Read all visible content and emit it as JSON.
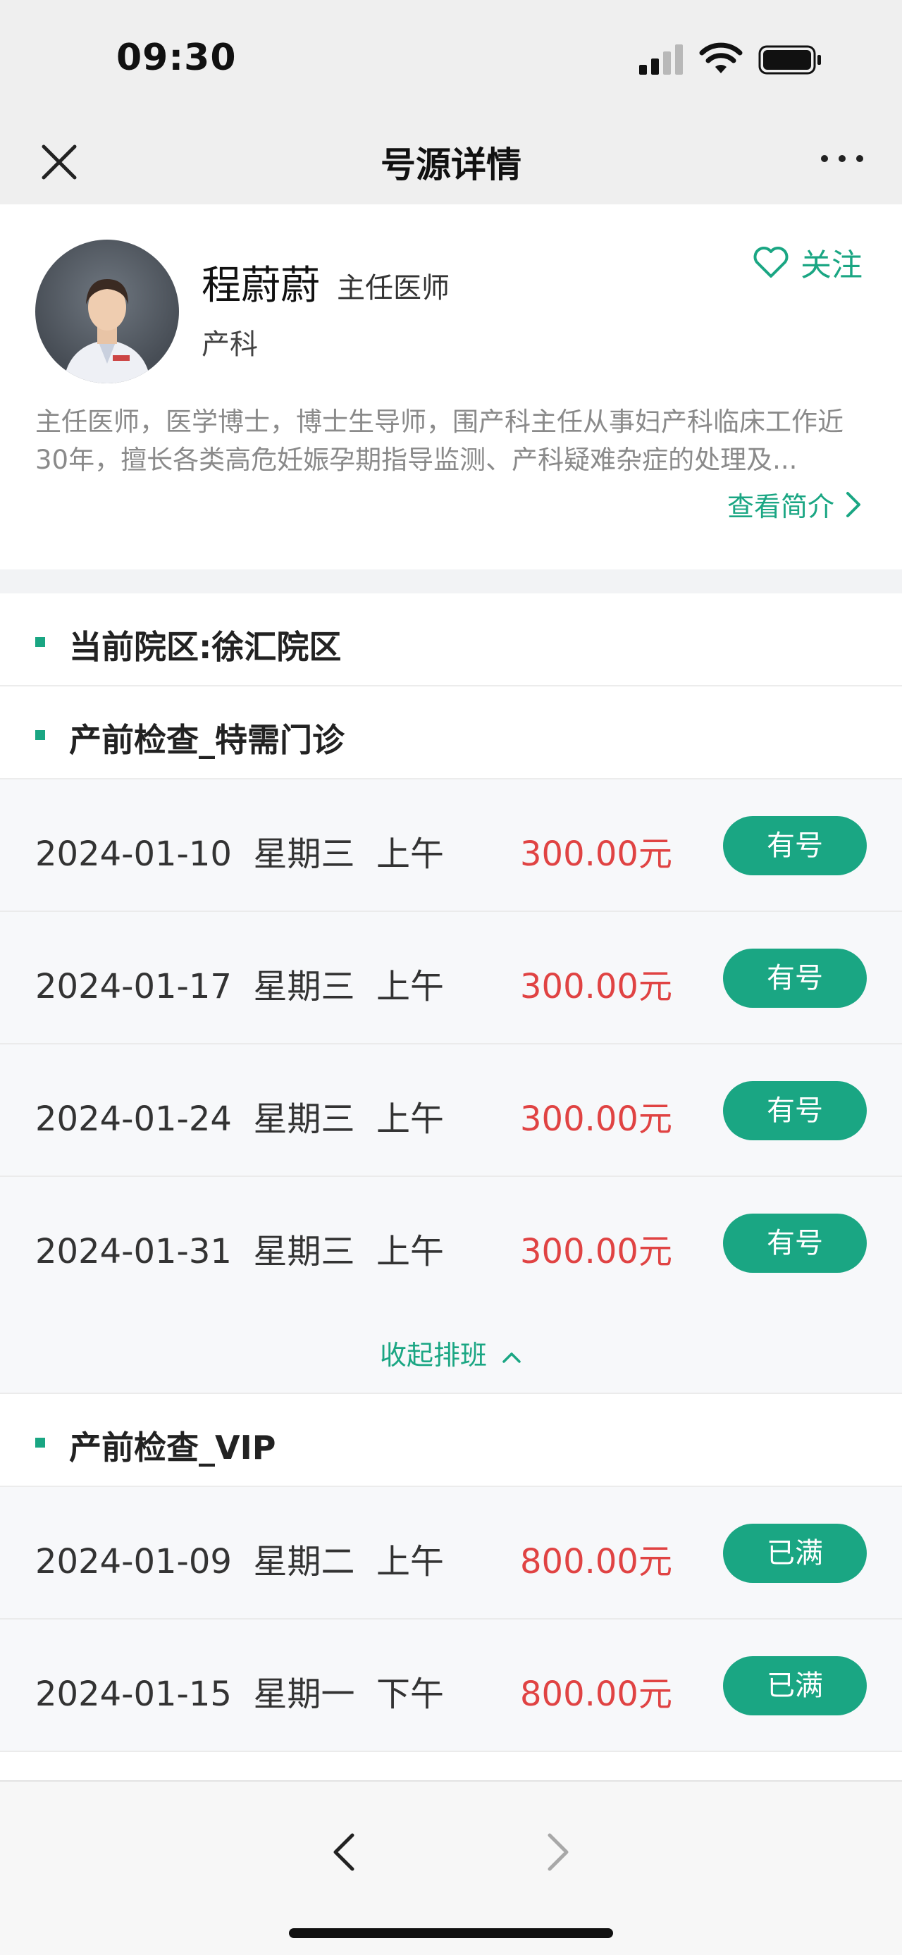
{
  "status": {
    "time": "09:30"
  },
  "nav": {
    "title": "号源详情"
  },
  "doctor": {
    "name": "程蔚蔚",
    "title": "主任医师",
    "department": "产科",
    "follow_label": "关注",
    "intro": "主任医师，医学博士，博士生导师，围产科主任从事妇产科临床工作近30年，擅长各类高危妊娠孕期指导监测、产科疑难杂症的处理及...",
    "intro_link": "查看简介"
  },
  "campus": {
    "label": "当前院区:徐汇院区"
  },
  "sections": [
    {
      "label": "产前检查_特需门诊",
      "rows": [
        {
          "date": "2024-01-10  星期三  上午",
          "price": "300.00元",
          "status": "有号"
        },
        {
          "date": "2024-01-17  星期三  上午",
          "price": "300.00元",
          "status": "有号"
        },
        {
          "date": "2024-01-24  星期三  上午",
          "price": "300.00元",
          "status": "有号"
        },
        {
          "date": "2024-01-31  星期三  上午",
          "price": "300.00元",
          "status": "有号"
        }
      ],
      "collapse_label": "收起排班"
    },
    {
      "label": "产前检查_VIP",
      "rows": [
        {
          "date": "2024-01-09  星期二  上午",
          "price": "800.00元",
          "status": "已满"
        },
        {
          "date": "2024-01-15  星期一  下午",
          "price": "800.00元",
          "status": "已满"
        }
      ]
    }
  ],
  "colors": {
    "accent": "#1aa683",
    "price": "#e04343",
    "page_bg": "#f2f3f5"
  },
  "icons": {
    "close": "close-icon",
    "more": "more-icon",
    "follow": "heart-icon",
    "intro_link": "chevron-right-icon",
    "collapse": "chevron-up-icon",
    "back": "back-arrow-icon",
    "forward": "forward-arrow-icon"
  }
}
